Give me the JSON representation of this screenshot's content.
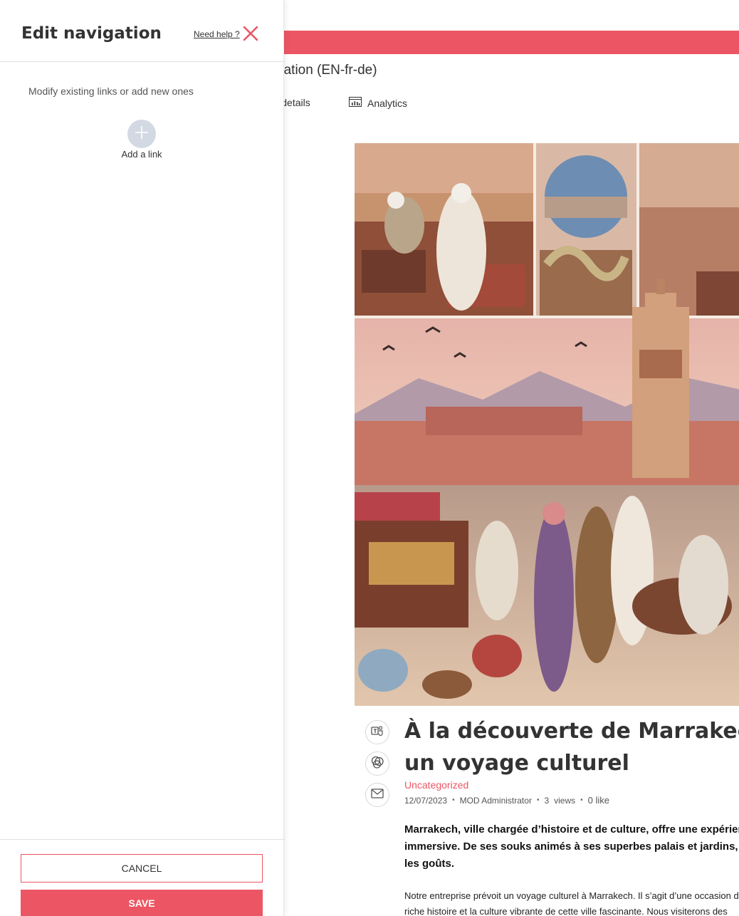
{
  "colors": {
    "accent": "#ec5664",
    "text": "#323130",
    "panel_bg": "#ffffff",
    "add_circle": "#d3d9e3"
  },
  "page": {
    "title": "variation (EN-fr-de)",
    "commands": {
      "page_details": "age details",
      "analytics": "Analytics"
    },
    "hero_image_description_icon": "marrakech-illustration-image",
    "share_icons": [
      "teams-icon",
      "yammer-icon",
      "mail-icon"
    ],
    "article": {
      "title": "À la découverte de Marrakech : un voyage culturel",
      "category": "Uncategorized",
      "date": "12/07/2023",
      "author": "MOD Administrator",
      "views_count": "3",
      "views_label": "views",
      "likes": "0 like",
      "lead": "Marrakech, ville chargée d’histoire et de culture, offre une expérience immersive. De ses souks animés à ses superbes palais et jardins, pour tous les goûts.",
      "body": "Notre entreprise prévoit un voyage culturel à Marrakech. Il s’agit d’une occasion de découvrir la riche histoire et la culture vibrante de cette ville fascinante. Nous visiterons des"
    }
  },
  "panel": {
    "title": "Edit navigation",
    "help_link": "Need help ?",
    "description": "Modify existing links or add new ones",
    "add_link_label": "Add a link",
    "cancel_label": "CANCEL",
    "save_label": "SAVE"
  }
}
